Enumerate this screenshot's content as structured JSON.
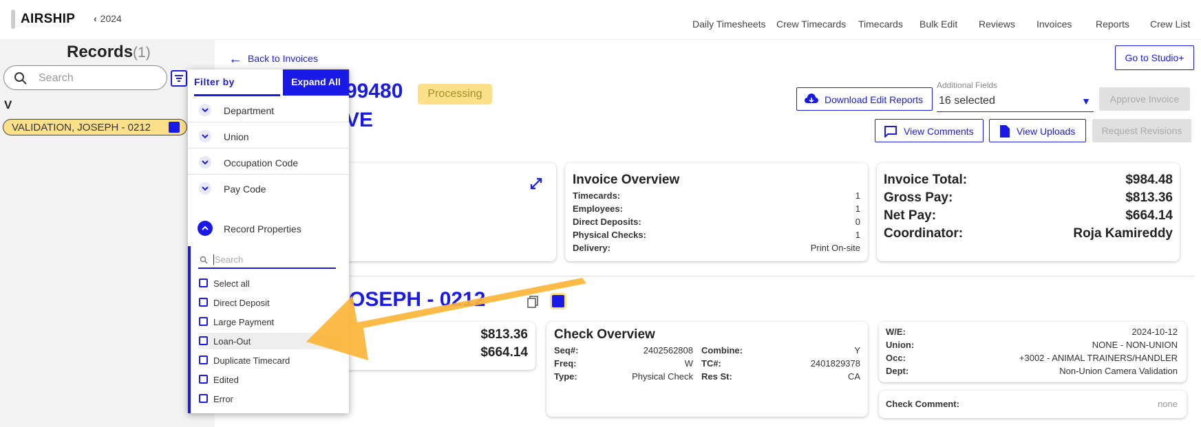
{
  "header": {
    "brand": "AIRSHIP",
    "year": "2024",
    "nav": [
      "Daily Timesheets",
      "Crew Timecards",
      "Timecards",
      "Bulk Edit",
      "Reviews",
      "Invoices",
      "Reports",
      "Crew List"
    ]
  },
  "left": {
    "title": "Records",
    "count": "(1)",
    "search_placeholder": "Search",
    "group_letter": "V",
    "record": "VALIDATION, JOSEPH - 0212"
  },
  "main": {
    "back_label": "Back to Invoices",
    "studio_label": "Go to Studio+",
    "invoice_number": "99480",
    "invoice_name": "VE",
    "status": "Processing",
    "download_label": "Download Edit Reports",
    "additional_fields_label": "Additional Fields",
    "additional_fields_value": "16 selected",
    "approve_label": "Approve Invoice",
    "comments_label": "View Comments",
    "uploads_label": "View Uploads",
    "revisions_label": "Request Revisions"
  },
  "overview": {
    "title": "Invoice Overview",
    "rows": [
      {
        "k": "Timecards:",
        "v": "1"
      },
      {
        "k": "Employees:",
        "v": "1"
      },
      {
        "k": "Direct Deposits:",
        "v": "0"
      },
      {
        "k": "Physical Checks:",
        "v": "1"
      },
      {
        "k": "Delivery:",
        "v": "Print On-site"
      }
    ]
  },
  "totals": [
    {
      "k": "Invoice Total:",
      "v": "$984.48"
    },
    {
      "k": "Gross Pay:",
      "v": "$813.36"
    },
    {
      "k": "Net Pay:",
      "v": "$664.14"
    },
    {
      "k": "Coordinator:",
      "v": "Roja Kamireddy"
    }
  ],
  "employee": {
    "name": "N, JOSEPH - 0212",
    "gross": "$813.36",
    "net": "$664.14"
  },
  "check": {
    "title": "Check Overview",
    "left_rows": [
      {
        "k": "Seq#:",
        "v": "2402562808"
      },
      {
        "k": "Freq:",
        "v": "W"
      },
      {
        "k": "Type:",
        "v": "Physical Check"
      }
    ],
    "right_rows": [
      {
        "k": "Combine:",
        "v": "Y"
      },
      {
        "k": "TC#:",
        "v": "2401829378"
      },
      {
        "k": "Res St:",
        "v": "CA"
      }
    ]
  },
  "details": [
    {
      "k": "W/E:",
      "v": "2024-10-12"
    },
    {
      "k": "Union:",
      "v": "NONE - NON-UNION"
    },
    {
      "k": "Occ:",
      "v": "+3002 - ANIMAL TRAINERS/HANDLER"
    },
    {
      "k": "Dept:",
      "v": "Non-Union Camera Validation"
    }
  ],
  "check_comment": {
    "k": "Check Comment:",
    "v": "none"
  },
  "filter": {
    "title": "Filter by",
    "expand_label": "Expand All",
    "sections": [
      "Department",
      "Union",
      "Occupation Code",
      "Pay Code",
      "Record Properties"
    ],
    "search_placeholder": "Search",
    "options": [
      "Select all",
      "Direct Deposit",
      "Large Payment",
      "Loan-Out",
      "Duplicate Timecard",
      "Edited",
      "Error"
    ]
  },
  "colors": {
    "accent": "#1a1ae6",
    "highlight": "#fde18a",
    "arrow": "#fbb536"
  }
}
